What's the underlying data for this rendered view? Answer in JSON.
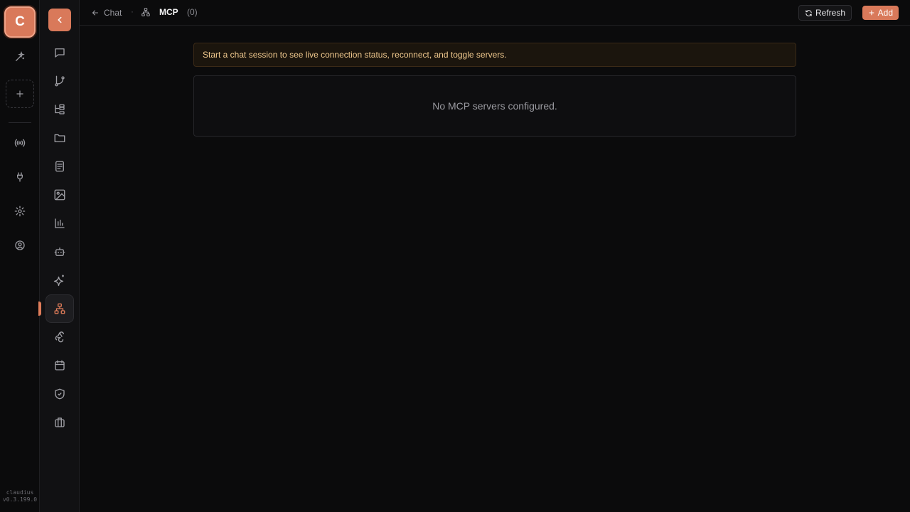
{
  "brand": {
    "letter": "C",
    "name": "claudius",
    "version": "v0.3.199.0",
    "accent": "#d9795a"
  },
  "rail_icons": [
    "magic-wand-icon",
    "plus-icon",
    "broadcast-icon",
    "plug-icon",
    "gear-icon",
    "user-circle-icon"
  ],
  "nav_icons": [
    "chat-icon",
    "git-branch-icon",
    "tree-icon",
    "folder-icon",
    "book-icon",
    "image-icon",
    "bar-chart-icon",
    "bot-icon",
    "sparkles-icon",
    "network-icon",
    "webhook-icon",
    "calendar-icon",
    "shield-check-icon",
    "briefcase-icon"
  ],
  "header": {
    "back_label": "Chat",
    "separator": "·",
    "title": "MCP",
    "count": "(0)",
    "refresh_label": "Refresh",
    "add_label": "Add"
  },
  "main": {
    "notice": "Start a chat session to see live connection status, reconnect, and toggle servers.",
    "empty_message": "No MCP servers configured."
  }
}
